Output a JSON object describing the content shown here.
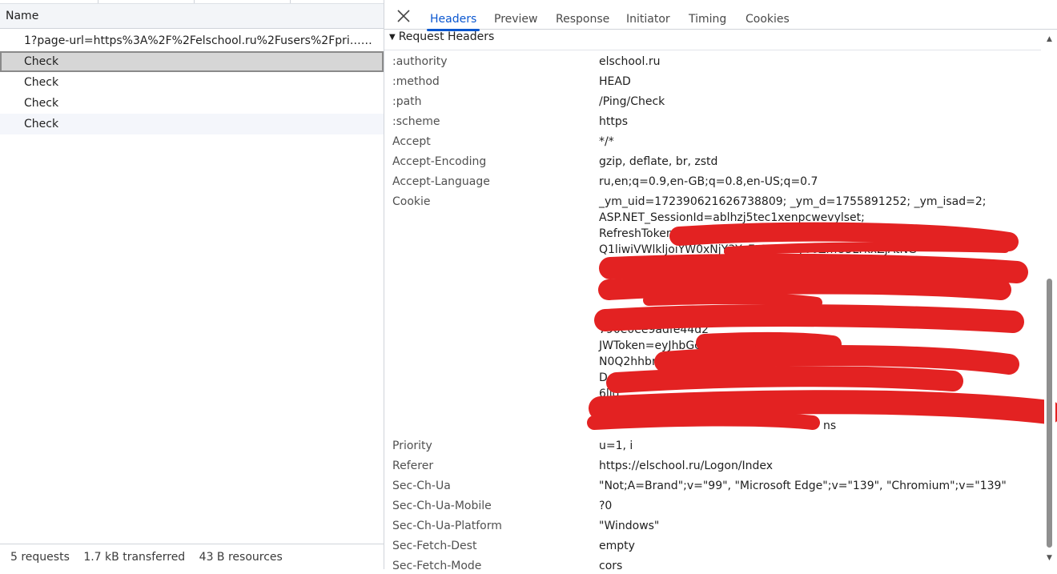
{
  "left": {
    "column_header": "Name",
    "requests": [
      {
        "label": "1?page-url=https%3A%2F%2Felschool.ru%2Fusers%2Fpri…e-info…"
      },
      {
        "label": "Check"
      },
      {
        "label": "Check"
      },
      {
        "label": "Check"
      },
      {
        "label": "Check"
      }
    ],
    "status": {
      "requests": "5 requests",
      "transferred": "1.7 kB transferred",
      "resources": "43 B resources"
    }
  },
  "tabs": [
    "Headers",
    "Preview",
    "Response",
    "Initiator",
    "Timing",
    "Cookies"
  ],
  "active_tab": "Headers",
  "section_title": "Request Headers",
  "headers": [
    {
      "key": ":authority",
      "value": "elschool.ru"
    },
    {
      "key": ":method",
      "value": "HEAD"
    },
    {
      "key": ":path",
      "value": "/Ping/Check"
    },
    {
      "key": ":scheme",
      "value": "https"
    },
    {
      "key": "Accept",
      "value": "*/*"
    },
    {
      "key": "Accept-Encoding",
      "value": "gzip, deflate, br, zstd"
    },
    {
      "key": "Accept-Language",
      "value": "ru,en;q=0.9,en-GB;q=0.8,en-US;q=0.7"
    },
    {
      "key": "Cookie",
      "value": "_ym_uid=172390621626738809; _ym_d=1755891252; _ym_isad=2;"
    }
  ],
  "cookie_lines": [
    "ASP.NET_SessionId=ablhzj5tec1xenpcwevylset;",
    "RefreshToken=",
    "Q1liwiVWlkljoiYW0xNjY3YzEtOTlmNy00ZmU3LTkxZjAtNG",
    "",
    "",
    "",
    "",
    "790e0ee9adfe44d2",
    "JWToken=eyJhbGciOi",
    "N0Q2hhbm",
    "D",
    "6ljq",
    "M",
    "ns"
  ],
  "headers_after": [
    {
      "key": "Priority",
      "value": "u=1, i"
    },
    {
      "key": "Referer",
      "value": "https://elschool.ru/Logon/Index"
    },
    {
      "key": "Sec-Ch-Ua",
      "value": "\"Not;A=Brand\";v=\"99\", \"Microsoft Edge\";v=\"139\", \"Chromium\";v=\"139\""
    },
    {
      "key": "Sec-Ch-Ua-Mobile",
      "value": "?0"
    },
    {
      "key": "Sec-Ch-Ua-Platform",
      "value": "\"Windows\""
    },
    {
      "key": "Sec-Fetch-Dest",
      "value": "empty"
    },
    {
      "key": "Sec-Fetch-Mode",
      "value": "cors"
    }
  ],
  "colors": {
    "accent": "#0b57d0",
    "redaction": "#e32222",
    "selected_row": "#d6d6d6"
  },
  "icons": {
    "close": "close-icon",
    "section_toggle": "triangle-down-icon",
    "scroll_up": "chevron-up-icon",
    "scroll_down": "chevron-down-icon"
  }
}
